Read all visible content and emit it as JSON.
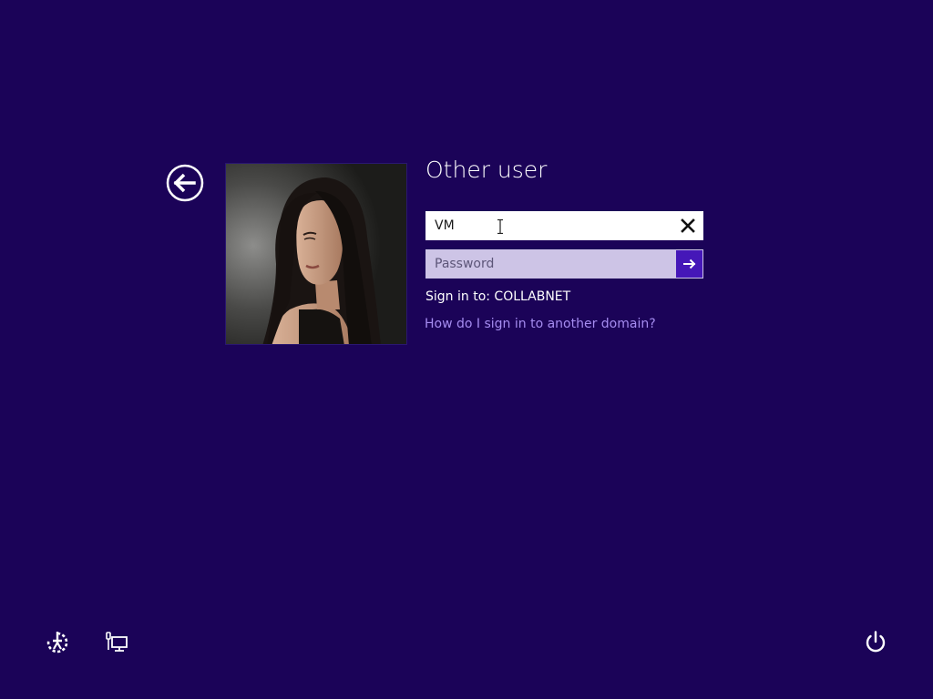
{
  "colors": {
    "background": "#1b0358",
    "link": "#a58cf0",
    "submit_button": "#4517b8",
    "password_field": "#cdc4e6"
  },
  "icons": {
    "back": "back-arrow-icon",
    "clear": "close-icon",
    "submit": "arrow-right-icon",
    "ease_of_access": "ease-of-access-icon",
    "network": "network-icon",
    "power": "power-icon",
    "text_cursor": "i-beam-cursor-icon"
  },
  "login": {
    "title": "Other user",
    "username_value": "VM",
    "password_placeholder": "Password",
    "sign_in_to": "Sign in to: COLLABNET",
    "domain_help_link": "How do I sign in to another domain?"
  }
}
